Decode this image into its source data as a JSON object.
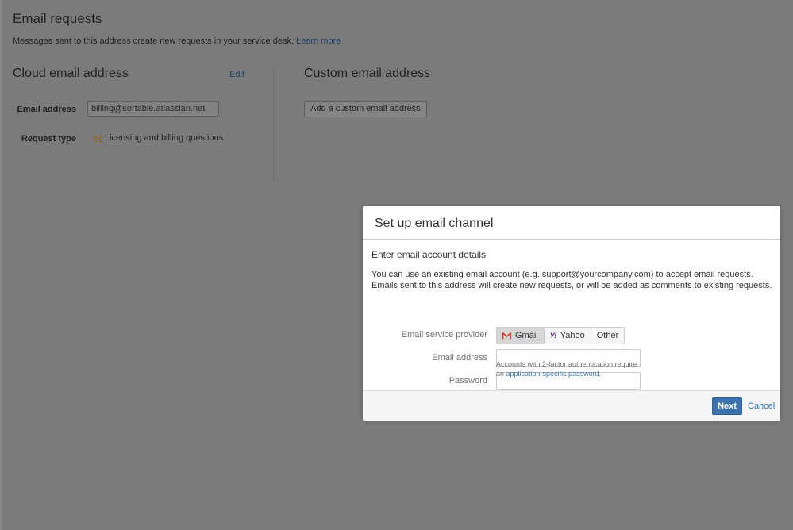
{
  "page": {
    "title": "Email requests",
    "description": "Messages sent to this address create new requests in your service desk.",
    "learn_more": "Learn more"
  },
  "cloud": {
    "title": "Cloud email address",
    "edit_label": "Edit",
    "email_label": "Email address",
    "email_value": "billing@sortable.atlassian.net",
    "request_type_label": "Request type",
    "request_type_value": "Licensing and billing questions"
  },
  "custom": {
    "title": "Custom email address",
    "add_button": "Add a custom email address"
  },
  "dialog": {
    "title": "Set up email channel",
    "subtitle": "Enter email account details",
    "intro": "You can use an existing email account (e.g. support@yourcompany.com) to accept email requests. Emails sent to this address will create new requests, or will be added as comments to existing requests.",
    "provider_label": "Email service provider",
    "providers": [
      "Gmail",
      "Yahoo",
      "Other"
    ],
    "selected_provider": "Gmail",
    "email_label": "Email address",
    "email_value": "",
    "password_label": "Password",
    "password_value": "",
    "help_prefix": "Accounts with 2-factor authentication require an",
    "help_link": "application-specific password",
    "help_suffix": ".",
    "next_label": "Next",
    "cancel_label": "Cancel"
  },
  "colors": {
    "overlay_background": "#7b7b7b",
    "primary_button": "#3b73af",
    "link": "#3572b0"
  }
}
